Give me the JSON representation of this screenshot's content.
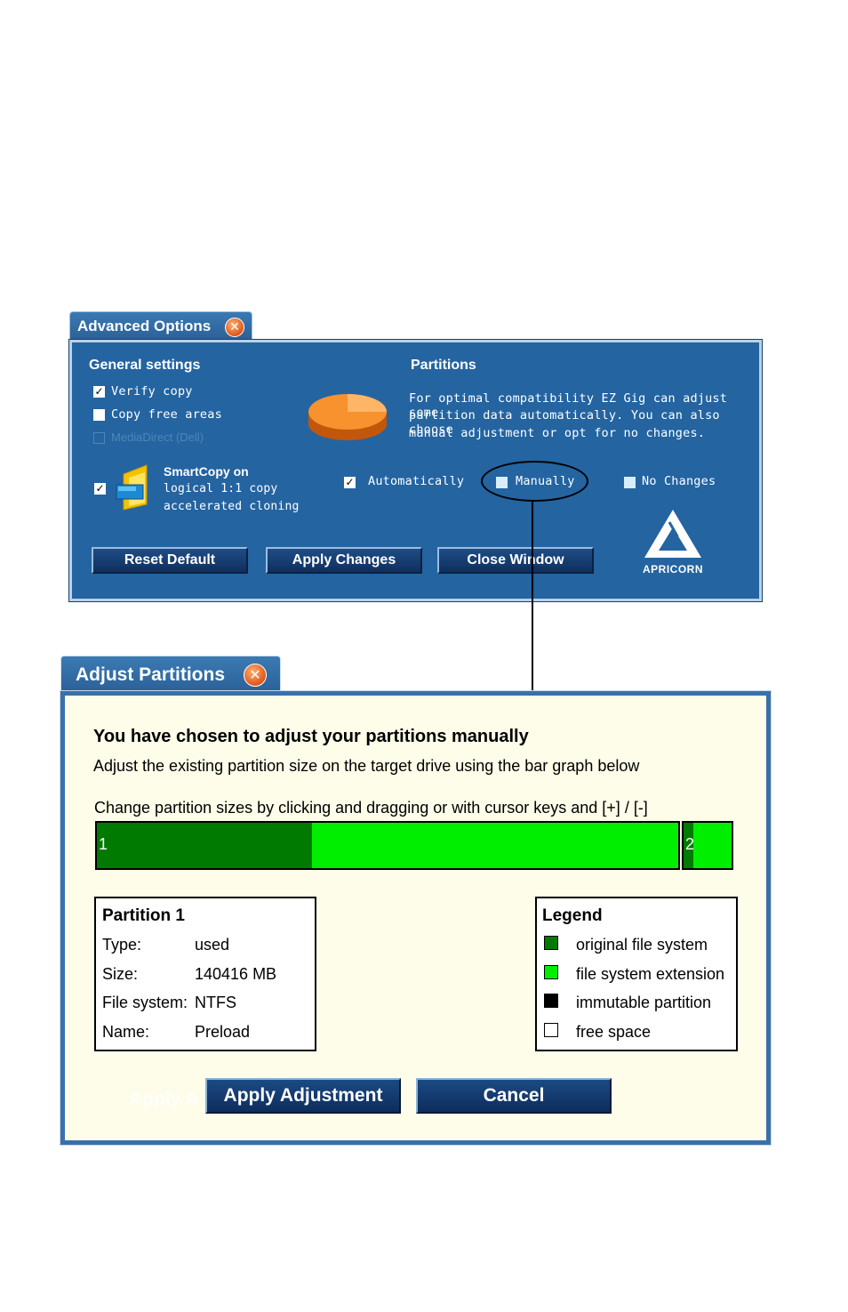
{
  "advanced_options": {
    "title": "Advanced Options",
    "close_icon": "x-icon",
    "general": {
      "heading": "General settings",
      "verify_copy": {
        "label": "Verify copy",
        "checked": true
      },
      "copy_free_areas": {
        "label": "Copy free areas",
        "checked": false
      },
      "mediadirect": {
        "label": "MediaDirect (Dell)",
        "checked": false,
        "enabled": false
      },
      "smartcopy": {
        "checked": true,
        "line1": "SmartCopy on",
        "line2": "logical 1:1 copy",
        "line3": "accelerated cloning"
      }
    },
    "partitions": {
      "heading": "Partitions",
      "description_lines": [
        "For optimal compatibility EZ Gig can adjust some",
        "partition data automatically. You can also choose",
        "manual adjustment or opt for no changes."
      ],
      "options": [
        {
          "label": "Automatically",
          "checked": true
        },
        {
          "label": "Manually",
          "checked": false
        },
        {
          "label": "No Changes",
          "checked": false
        }
      ]
    },
    "buttons": {
      "reset_default": "Reset Default",
      "apply_changes": "Apply Changes",
      "close_window": "Close Window"
    },
    "logo_text": "APRICORN"
  },
  "adjust_partitions": {
    "title": "Adjust Partitions",
    "heading": "You have chosen to adjust your partitions manually",
    "subheading": "Adjust the existing partition size on the target drive using the bar graph below",
    "instruction": "Change partition sizes by clicking and dragging or with cursor keys and [+] / [-]",
    "bar": [
      {
        "label": "1",
        "used_fraction": 0.37
      },
      {
        "label": "2",
        "used_fraction": 0.2
      }
    ],
    "partition_info": {
      "title": "Partition 1",
      "rows": [
        {
          "key": "Type:",
          "value": "used"
        },
        {
          "key": "Size:",
          "value": "140416 MB"
        },
        {
          "key": "File system:",
          "value": "NTFS"
        },
        {
          "key": "Name:",
          "value": "Preload"
        }
      ]
    },
    "legend": {
      "title": "Legend",
      "items": [
        {
          "label": "original file system",
          "color": "#007a00"
        },
        {
          "label": "file system extension",
          "color": "#00ee00"
        },
        {
          "label": "immutable partition",
          "color": "#000000"
        },
        {
          "label": "free space",
          "color": "#ffffff"
        }
      ]
    },
    "buttons": {
      "ghost_label": "Apply A",
      "apply_adjustment": "Apply Adjustment",
      "cancel": "Cancel"
    }
  },
  "colors": {
    "adv_panel_bg": "#2464a0",
    "adj_panel_bg": "#fdfde9",
    "original_fs": "#007a00",
    "fs_extension": "#00ee00"
  }
}
